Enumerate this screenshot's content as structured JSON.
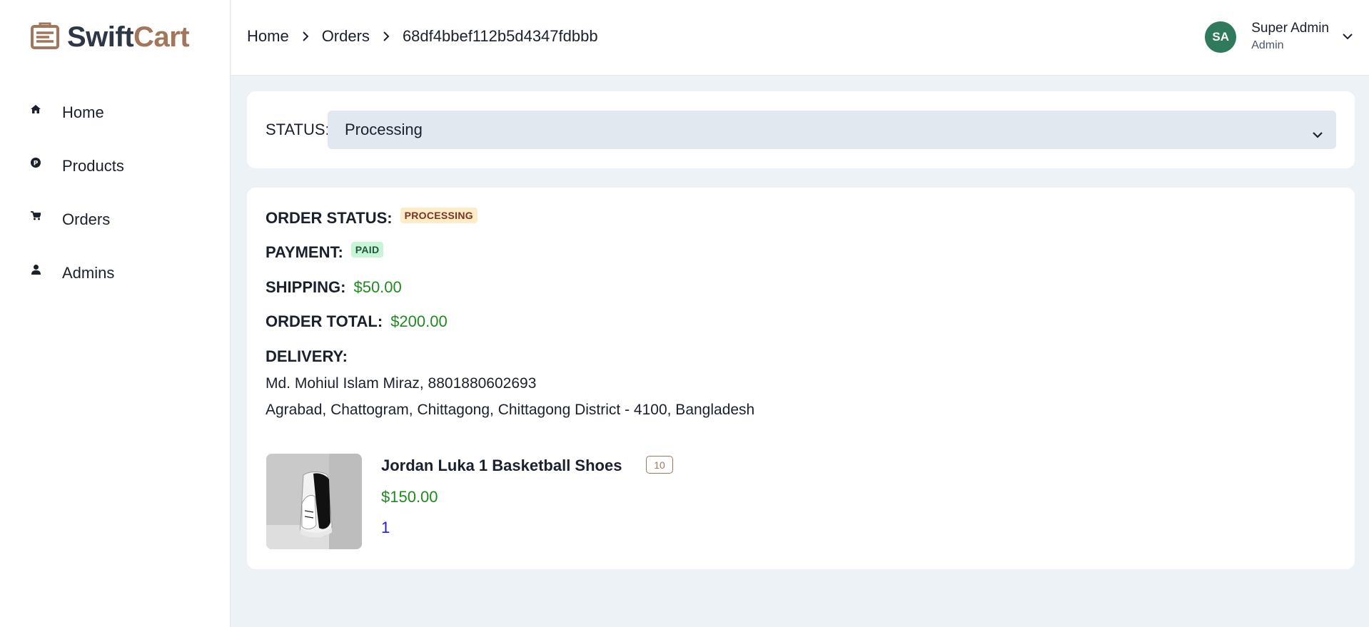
{
  "brand": {
    "swift": "Swift",
    "cart": "Cart",
    "accent": "#a3755a"
  },
  "sidebar": {
    "items": [
      {
        "label": "Home",
        "icon": "home-icon"
      },
      {
        "label": "Products",
        "icon": "product-icon"
      },
      {
        "label": "Orders",
        "icon": "cart-icon"
      },
      {
        "label": "Admins",
        "icon": "user-icon"
      }
    ]
  },
  "breadcrumb": [
    "Home",
    "Orders",
    "68df4bbef112b5d4347fdbbb"
  ],
  "user": {
    "initials": "SA",
    "name": "Super Admin",
    "role": "Admin",
    "avatar_color": "#2f7a5c"
  },
  "status": {
    "label": "STATUS:",
    "selected": "Processing"
  },
  "order": {
    "status_label": "ORDER STATUS:",
    "status_badge": "PROCESSING",
    "payment_label": "PAYMENT:",
    "payment_badge": "PAID",
    "shipping_label": "SHIPPING:",
    "shipping_value": "$50.00",
    "total_label": "ORDER TOTAL:",
    "total_value": "$200.00",
    "delivery_label": "DELIVERY:",
    "delivery_line1": "Md. Mohiul Islam Miraz, 8801880602693",
    "delivery_line2": "Agrabad, Chattogram, Chittagong, Chittagong District - 4100, Bangladesh"
  },
  "items": [
    {
      "name": "Jordan Luka 1 Basketball Shoes",
      "stock": "10",
      "price": "$150.00",
      "quantity": "1"
    }
  ]
}
